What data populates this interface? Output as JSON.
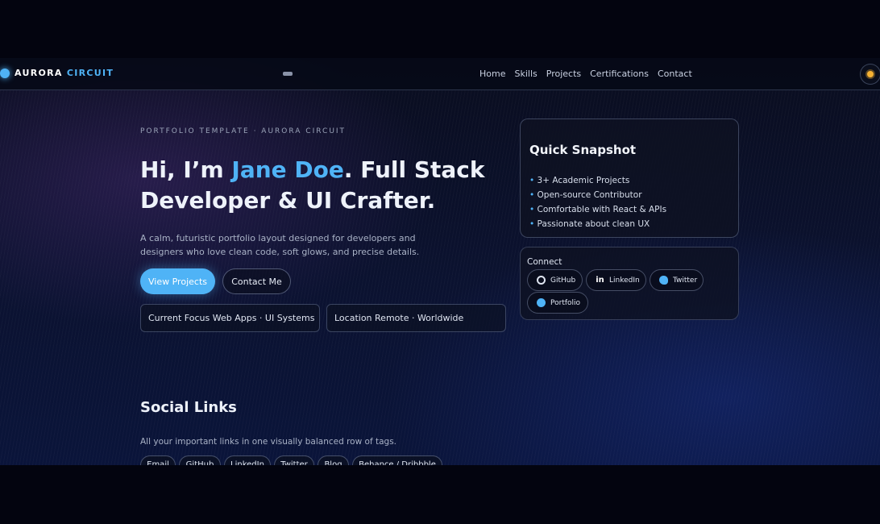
{
  "brand": {
    "name_part1": "AURORA",
    "name_part2": "CIRCUIT"
  },
  "nav": {
    "links": [
      "Home",
      "Skills",
      "Projects",
      "Certifications",
      "Contact"
    ]
  },
  "hero": {
    "eyebrow": "PORTFOLIO TEMPLATE · AURORA CIRCUIT",
    "title_prefix": "Hi, I’m ",
    "title_name": "Jane Doe",
    "title_suffix": ". Full Stack Developer & UI Crafter.",
    "description": "A calm, futuristic portfolio layout designed for developers and designers who love clean code, soft glows, and precise details.",
    "primary_button": "View Projects",
    "secondary_button": "Contact Me",
    "focus_card": "Current Focus Web Apps · UI Systems",
    "location_card": "Location Remote · Worldwide"
  },
  "snapshot": {
    "title": "Quick Snapshot",
    "items": [
      "3+ Academic Projects",
      "Open-source Contributor",
      "Comfortable with React & APIs",
      "Passionate about clean UX"
    ]
  },
  "connect": {
    "title": "Connect",
    "links": [
      {
        "label": "GitHub",
        "icon": "github-icon"
      },
      {
        "label": "LinkedIn",
        "icon": "linkedin-icon"
      },
      {
        "label": "Twitter",
        "icon": "twitter-icon"
      },
      {
        "label": "Portfolio",
        "icon": "globe-icon"
      }
    ]
  },
  "social": {
    "title": "Social Links",
    "description": "All your important links in one visually balanced row of tags.",
    "tags": [
      "Email",
      "GitHub",
      "LinkedIn",
      "Twitter",
      "Blog",
      "Behance / Dribbble"
    ]
  },
  "colors": {
    "accent": "#4fb3f6",
    "background": "#0a0d1f",
    "sun": "#f6b233"
  }
}
